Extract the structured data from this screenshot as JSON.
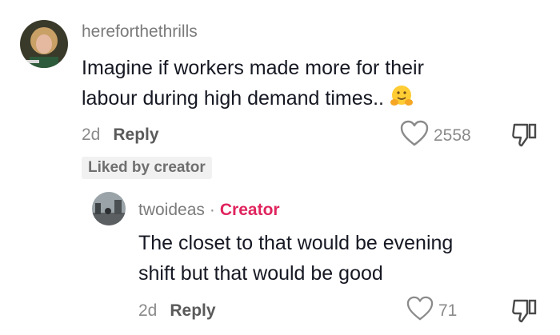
{
  "comment": {
    "username": "hereforthethrills",
    "text_line1": "Imagine if workers made more for their",
    "text_line2": "labour during high demand times..",
    "emoji": "hugging-face-emoji",
    "time": "2d",
    "reply_label": "Reply",
    "like_count": "2558",
    "liked_by_creator": "Liked by creator"
  },
  "reply": {
    "username": "twoideas",
    "separator": "·",
    "creator_tag": "Creator",
    "text_line1": "The closet to that would be evening",
    "text_line2": "shift but that would be good",
    "time": "2d",
    "reply_label": "Reply",
    "like_count": "71"
  },
  "colors": {
    "creator_tag": "#e0245e",
    "username": "#7b7b7b",
    "text": "#161823"
  }
}
